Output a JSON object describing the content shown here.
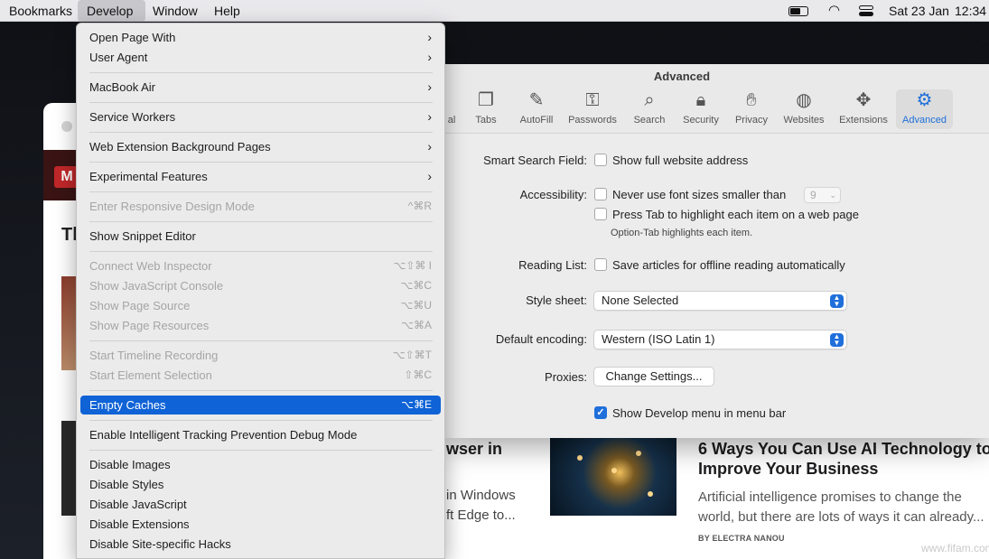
{
  "menubar": {
    "items": [
      "Bookmarks",
      "Develop",
      "Window",
      "Help"
    ],
    "date": "Sat 23 Jan",
    "time": "12:34",
    "icons": [
      "battery-icon",
      "wifi-icon",
      "control-center-icon"
    ]
  },
  "develop_menu": {
    "open_page_with": "Open Page With",
    "user_agent": "User Agent",
    "macbook_air": "MacBook Air",
    "service_workers": "Service Workers",
    "web_ext_bg_pages": "Web Extension Background Pages",
    "experimental_features": "Experimental Features",
    "responsive_design": {
      "label": "Enter Responsive Design Mode",
      "shortcut": "^⌘R"
    },
    "snippet_editor": "Show Snippet Editor",
    "connect_inspector": {
      "label": "Connect Web Inspector",
      "shortcut": "⌥⇧⌘ I"
    },
    "js_console": {
      "label": "Show JavaScript Console",
      "shortcut": "⌥⌘C"
    },
    "page_source": {
      "label": "Show Page Source",
      "shortcut": "⌥⌘U"
    },
    "page_resources": {
      "label": "Show Page Resources",
      "shortcut": "⌥⌘A"
    },
    "timeline": {
      "label": "Start Timeline Recording",
      "shortcut": "⌥⇧⌘T"
    },
    "element_selection": {
      "label": "Start Element Selection",
      "shortcut": "⇧⌘C"
    },
    "empty_caches": {
      "label": "Empty Caches",
      "shortcut": "⌥⌘E"
    },
    "itp_debug": "Enable Intelligent Tracking Prevention Debug Mode",
    "disable_images": "Disable Images",
    "disable_styles": "Disable Styles",
    "disable_javascript": "Disable JavaScript",
    "disable_extensions": "Disable Extensions",
    "disable_hacks": "Disable Site-specific Hacks"
  },
  "prefs": {
    "title": "Advanced",
    "tabs": [
      "al",
      "Tabs",
      "AutoFill",
      "Passwords",
      "Search",
      "Security",
      "Privacy",
      "Websites",
      "Extensions",
      "Advanced"
    ],
    "smart_search_label": "Smart Search Field:",
    "smart_search_option": "Show full website address",
    "accessibility_label": "Accessibility:",
    "font_size_option": "Never use font sizes smaller than",
    "font_size_value": "9",
    "tab_highlight_option": "Press Tab to highlight each item on a web page",
    "option_tab_hint": "Option-Tab highlights each item.",
    "reading_list_label": "Reading List:",
    "reading_list_option": "Save articles for offline reading automatically",
    "style_sheet_label": "Style sheet:",
    "style_sheet_value": "None Selected",
    "encoding_label": "Default encoding:",
    "encoding_value": "Western (ISO Latin 1)",
    "proxies_label": "Proxies:",
    "proxies_button": "Change Settings...",
    "develop_menu_option": "Show Develop menu in menu bar"
  },
  "background": {
    "logo_letter": "M",
    "headline_fragment": "Tl",
    "left_title_fragment": "wser in",
    "left_line1_fragment": "in Windows",
    "left_line2_fragment": "ft Edge to...",
    "article_title": "6 Ways You Can Use AI Technology to Improve Your Business",
    "article_desc": "Artificial intelligence promises to change the world, but there are lots of ways it can already...",
    "article_author": "BY ELECTRA NANOU",
    "watermark": "www.fifam.com"
  }
}
